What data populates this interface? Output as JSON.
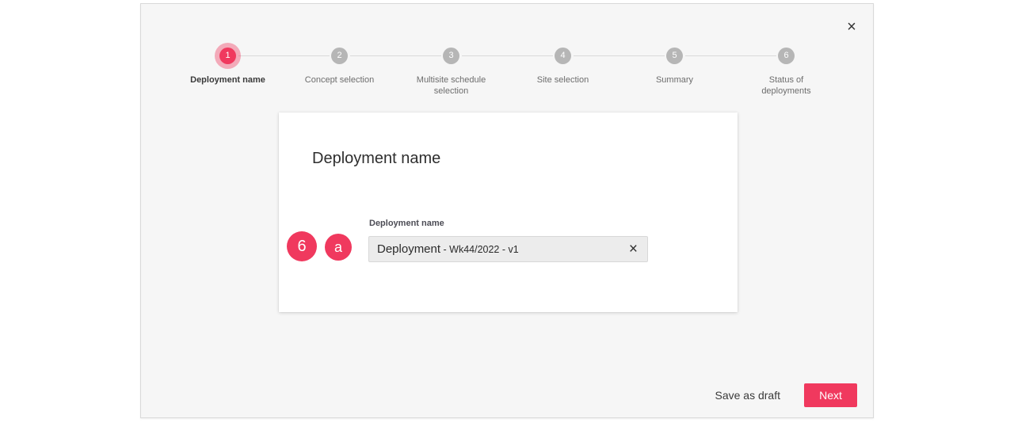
{
  "icons": {
    "close": "×",
    "clear": "×"
  },
  "dialog": {
    "stepper": {
      "steps": [
        {
          "number": "1",
          "label": "Deployment name",
          "state": "active"
        },
        {
          "number": "2",
          "label": "Concept selection",
          "state": "upcoming"
        },
        {
          "number": "3",
          "label": "Multisite schedule selection",
          "state": "upcoming"
        },
        {
          "number": "4",
          "label": "Site selection",
          "state": "upcoming"
        },
        {
          "number": "5",
          "label": "Summary",
          "state": "upcoming"
        },
        {
          "number": "6",
          "label": "Status of deployments",
          "state": "upcoming"
        }
      ]
    },
    "card": {
      "title": "Deployment name",
      "field": {
        "label": "Deployment name",
        "value": "Deployment - Wk44/2022 - v1",
        "value_primary": "Deployment",
        "value_suffix": " - Wk44/2022 - v1"
      }
    },
    "annotations": [
      {
        "label": "6"
      },
      {
        "label": "a"
      }
    ],
    "footer": {
      "save_draft_label": "Save as draft",
      "next_label": "Next"
    },
    "colors": {
      "accent": "#f0395e",
      "step_inactive": "#b6b6b6",
      "dialog_background": "#f6f6f6",
      "input_background": "#ececec"
    }
  }
}
